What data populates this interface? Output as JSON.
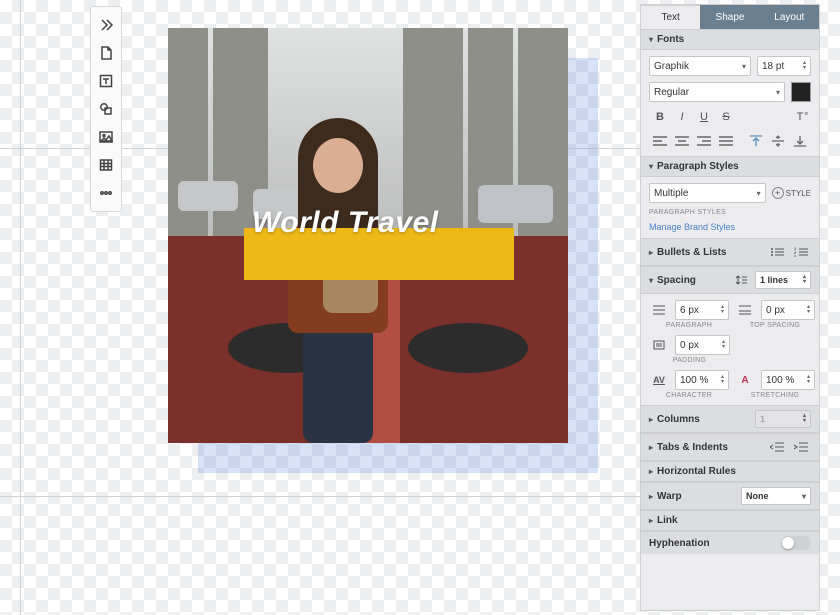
{
  "canvas": {
    "title_text": "World Travel"
  },
  "toolbar": {
    "tools": [
      "expand",
      "page",
      "text",
      "shape",
      "image",
      "table",
      "more"
    ]
  },
  "panel": {
    "tabs": {
      "text": "Text",
      "shape": "Shape",
      "layout": "Layout",
      "active": "text"
    },
    "fonts": {
      "header": "Fonts",
      "family": "Graphik",
      "size": "18 pt",
      "weight": "Regular",
      "color": "#222222",
      "style_buttons": {
        "bold": "B",
        "italic": "I",
        "underline": "U",
        "strike": "S",
        "clear": "T"
      },
      "align_buttons": [
        "left",
        "center",
        "right",
        "justify"
      ],
      "valign_buttons": [
        "top",
        "middle",
        "bottom"
      ]
    },
    "para_styles": {
      "header": "Paragraph Styles",
      "value": "Multiple",
      "add_label": "STYLE",
      "sublabel": "PARAGRAPH STYLES",
      "link": "Manage Brand Styles"
    },
    "bullets": {
      "header": "Bullets & Lists"
    },
    "spacing": {
      "header": "Spacing",
      "line_spacing": "1 lines",
      "paragraph": "6 px",
      "paragraph_label": "PARAGRAPH",
      "top_spacing": "0 px",
      "top_spacing_label": "TOP SPACING",
      "padding": "0 px",
      "padding_label": "PADDING",
      "character": "100 %",
      "character_label": "CHARACTER",
      "stretching": "100 %",
      "stretching_label": "STRETCHING"
    },
    "columns": {
      "header": "Columns",
      "value": "1"
    },
    "tabs_indents": {
      "header": "Tabs & Indents"
    },
    "hrules": {
      "header": "Horizontal Rules"
    },
    "warp": {
      "header": "Warp",
      "value": "None"
    },
    "link_section": {
      "header": "Link"
    },
    "hyphenation": {
      "header": "Hyphenation"
    }
  }
}
